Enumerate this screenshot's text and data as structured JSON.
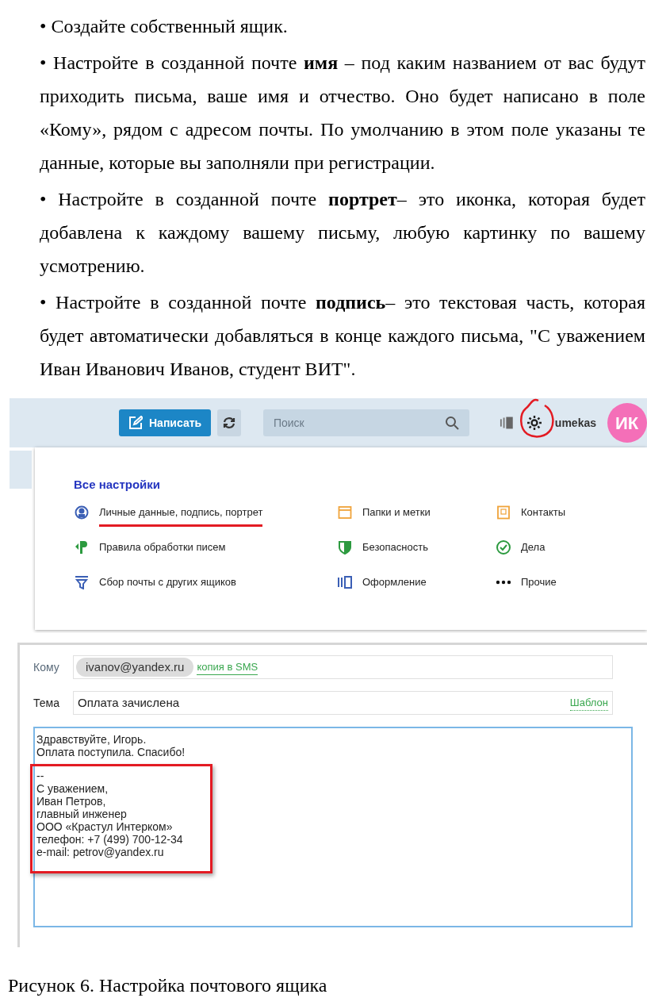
{
  "paragraphs": [
    {
      "text": "• Создайте собственный ящик."
    },
    {
      "text": "• Настройте в созданной почте **имя** – под каким названием от вас будут приходить письма, ваше имя и отчество. Оно будет написано в поле «Кому», рядом с адресом почты. По умолчанию в этом поле указаны те данные, которые вы заполняли при регистрации."
    },
    {
      "text": "• Настройте в созданной почте **портрет**– это иконка, которая будет добавлена к каждому вашему письму, любую картинку по вашему усмотрению."
    },
    {
      "text": "• Настройте в созданной почте **подпись**– это текстовая часть, которая будет автоматически добавляться в конце каждого письма, \"С уважением Иван Иванович Иванов, студент ВИТ\"."
    }
  ],
  "mail_toolbar": {
    "compose_button": "Написать",
    "search": {
      "placeholder": "Поиск"
    },
    "settings_circled": true,
    "username": "umekas",
    "avatar": "ИК"
  },
  "settings_menu": {
    "title": "Все настройки",
    "items": [
      {
        "label": "Личные данные, подпись, портрет",
        "kind": "person",
        "underlined": true
      },
      {
        "label": "Папки и метки",
        "kind": "folder",
        "underlined": false
      },
      {
        "label": "Контакты",
        "kind": "contacts",
        "underlined": false
      },
      {
        "label": "Правила обработки писем",
        "kind": "rules",
        "underlined": false
      },
      {
        "label": "Безопасность",
        "kind": "shield",
        "underlined": false
      },
      {
        "label": "Дела",
        "kind": "check",
        "underlined": false
      },
      {
        "label": "Сбор почты с других ящиков",
        "kind": "filter",
        "underlined": false
      },
      {
        "label": "Оформление",
        "kind": "theme",
        "underlined": false
      },
      {
        "label": "Прочие",
        "kind": "more",
        "underlined": false
      }
    ]
  },
  "compose": {
    "to_label": "Кому",
    "recipient": "ivanov@yandex.ru",
    "sms_link": "копия в SMS",
    "subject_label": "Тема",
    "subject": "Оплата зачислена",
    "template_link": "Шаблон",
    "body": "Здравствуйте, Игорь.\nОплата поступила. Спасибо!",
    "signature": "--\nС уважением,\nИван Петров,\nглавный инженер\nООО «Крастул Интерком»\nтелефон: +7 (499) 700-12-34\ne-mail: petrov@yandex.ru",
    "signature_highlighted": true
  },
  "caption": "Рисунок 6. Настройка почтового ящика"
}
